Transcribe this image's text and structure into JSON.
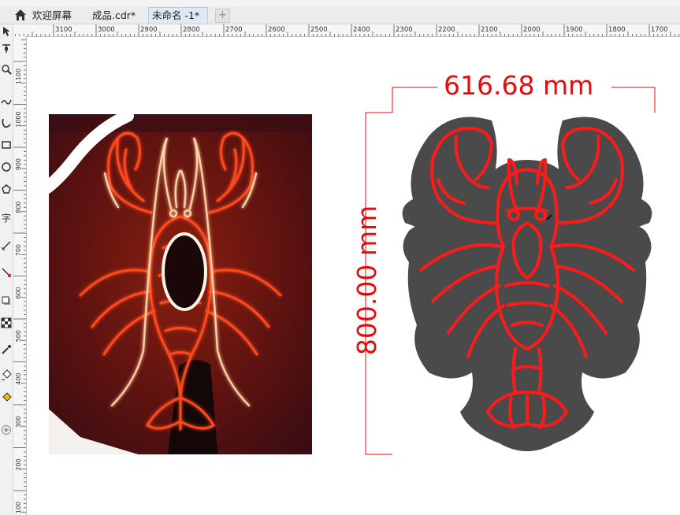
{
  "tabs": {
    "home_icon": "home-icon",
    "items": [
      {
        "label": "欢迎屏幕"
      },
      {
        "label": "成品.cdr*"
      },
      {
        "label": "未命名 -1*"
      }
    ],
    "add_label": "+"
  },
  "ruler": {
    "h_labels": [
      "3100",
      "3000",
      "2900",
      "2800",
      "2700",
      "2600",
      "2500",
      "2400",
      "2300",
      "2200",
      "2100",
      "2000",
      "1900",
      "1800",
      "1700"
    ],
    "v_labels": [
      "1100",
      "1000",
      "900",
      "800",
      "700",
      "600",
      "500",
      "400",
      "300",
      "200",
      "100"
    ]
  },
  "dimensions": {
    "width_label": "616.68 mm",
    "height_label": "800.00 mm",
    "color": "#e30d0d"
  },
  "artwork": {
    "neon_color": "#ff1a1a",
    "backboard_color": "#4a4a4a"
  }
}
